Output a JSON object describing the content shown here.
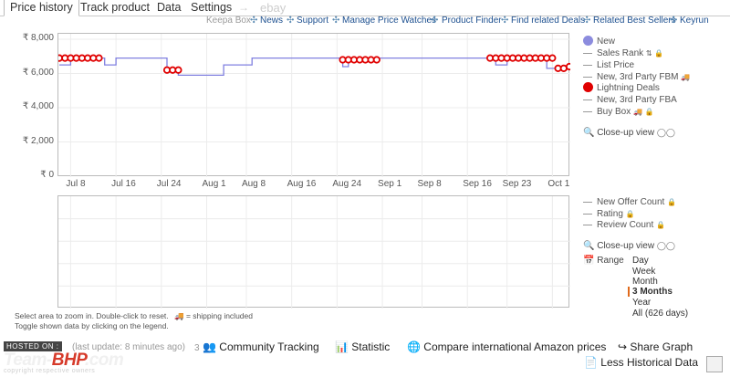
{
  "tabs": {
    "price_history": "Price history",
    "track_product": "Track product",
    "data": "Data",
    "settings": "Settings",
    "arrow": "→",
    "ebay": "ebay"
  },
  "links": {
    "keepa_box": "Keepa Box",
    "news": "News",
    "support": "Support",
    "manage_price_watches": "Manage Price Watches",
    "product_finder": "Product Finder",
    "find_related_deals": "Find related Deals",
    "related_best_sellers": "Related Best Sellers",
    "keyrun": "Keyrun",
    "separator": "✣"
  },
  "chart_data": {
    "type": "line",
    "y_ticks": [
      "₹ 8,000",
      "₹ 6,000",
      "₹ 4,000",
      "₹ 2,000",
      "₹ 0"
    ],
    "ylim": [
      0,
      8000
    ],
    "x_ticks": [
      "Jul 8",
      "Jul 16",
      "Jul 24",
      "Aug 1",
      "Aug 8",
      "Aug 16",
      "Aug 24",
      "Sep 1",
      "Sep 8",
      "Sep 16",
      "Sep 23",
      "Oct 1"
    ],
    "series": [
      {
        "name": "New",
        "color": "#8080e0",
        "points": [
          [
            "Jul 6",
            6500
          ],
          [
            "Jul 8",
            6500
          ],
          [
            "Jul 8",
            6900
          ],
          [
            "Jul 14",
            6900
          ],
          [
            "Jul 14",
            6500
          ],
          [
            "Jul 16",
            6500
          ],
          [
            "Jul 16",
            6900
          ],
          [
            "Jul 25",
            6900
          ],
          [
            "Jul 25",
            6200
          ],
          [
            "Jul 27",
            6200
          ],
          [
            "Jul 27",
            5900
          ],
          [
            "Aug 4",
            5900
          ],
          [
            "Aug 4",
            6500
          ],
          [
            "Aug 9",
            6500
          ],
          [
            "Aug 9",
            6900
          ],
          [
            "Aug 25",
            6900
          ],
          [
            "Aug 25",
            6400
          ],
          [
            "Aug 26",
            6400
          ],
          [
            "Aug 26",
            6900
          ],
          [
            "Sep 20",
            6900
          ],
          [
            "Sep 20",
            6800
          ],
          [
            "Sep 21",
            6800
          ],
          [
            "Sep 21",
            6500
          ],
          [
            "Sep 23",
            6500
          ],
          [
            "Sep 23",
            6900
          ],
          [
            "Sep 30",
            6900
          ],
          [
            "Sep 30",
            6300
          ],
          [
            "Oct 3",
            6300
          ],
          [
            "Oct 3",
            6100
          ]
        ]
      },
      {
        "name": "Lightning Deals",
        "color": "#e00000",
        "dots": [
          [
            "Jul 6",
            6900
          ],
          [
            "Jul 7",
            6900
          ],
          [
            "Jul 8",
            6900
          ],
          [
            "Jul 9",
            6900
          ],
          [
            "Jul 10",
            6900
          ],
          [
            "Jul 11",
            6900
          ],
          [
            "Jul 12",
            6900
          ],
          [
            "Jul 13",
            6900
          ],
          [
            "Jul 25",
            6200
          ],
          [
            "Jul 26",
            6200
          ],
          [
            "Jul 27",
            6200
          ],
          [
            "Aug 25",
            6800
          ],
          [
            "Aug 26",
            6800
          ],
          [
            "Aug 27",
            6800
          ],
          [
            "Aug 28",
            6800
          ],
          [
            "Aug 29",
            6800
          ],
          [
            "Aug 30",
            6800
          ],
          [
            "Aug 31",
            6800
          ],
          [
            "Sep 20",
            6900
          ],
          [
            "Sep 21",
            6900
          ],
          [
            "Sep 22",
            6900
          ],
          [
            "Sep 23",
            6900
          ],
          [
            "Sep 24",
            6900
          ],
          [
            "Sep 25",
            6900
          ],
          [
            "Sep 26",
            6900
          ],
          [
            "Sep 27",
            6900
          ],
          [
            "Sep 28",
            6900
          ],
          [
            "Sep 29",
            6900
          ],
          [
            "Sep 30",
            6900
          ],
          [
            "Oct 1",
            6900
          ],
          [
            "Oct 2",
            6300
          ],
          [
            "Oct 3",
            6300
          ],
          [
            "Oct 4",
            6400
          ]
        ]
      }
    ]
  },
  "legend": {
    "new": "New",
    "sales_rank": "Sales Rank",
    "list_price": "List Price",
    "new_3p_fbm": "New, 3rd Party FBM",
    "lightning_deals": "Lightning Deals",
    "new_3p_fba": "New, 3rd Party FBA",
    "buy_box": "Buy Box",
    "closeup_view": "Close-up view",
    "new_offer_count": "New Offer Count",
    "rating": "Rating",
    "review_count": "Review Count",
    "closeup_view_2": "Close-up view"
  },
  "range": {
    "label": "Range",
    "options": [
      "Day",
      "Week",
      "Month",
      "3 Months",
      "Year",
      "All (626 days)"
    ],
    "selected": "3 Months"
  },
  "hints": {
    "line1": "Select area to zoom in. Double-click to reset.",
    "shipping": "= shipping included",
    "line2": "Toggle shown data by clicking on the legend."
  },
  "bottom": {
    "hosted_on": "HOSTED ON :",
    "logo_main": "Team-",
    "logo_accent": "BHP",
    "logo_tail": ".com",
    "copyright": "copyright respective owners",
    "last_update": "(last update: 8 minutes ago)",
    "tracking_count": "3",
    "community_tracking": "Community Tracking",
    "statistic": "Statistic",
    "compare": "Compare international Amazon prices",
    "share": "Share Graph",
    "less_historical": "Less Historical Data"
  },
  "colors": {
    "new_line": "#8080e0",
    "lightning": "#e00000",
    "link": "#1c4f8f",
    "accent": "#e06a1b"
  }
}
